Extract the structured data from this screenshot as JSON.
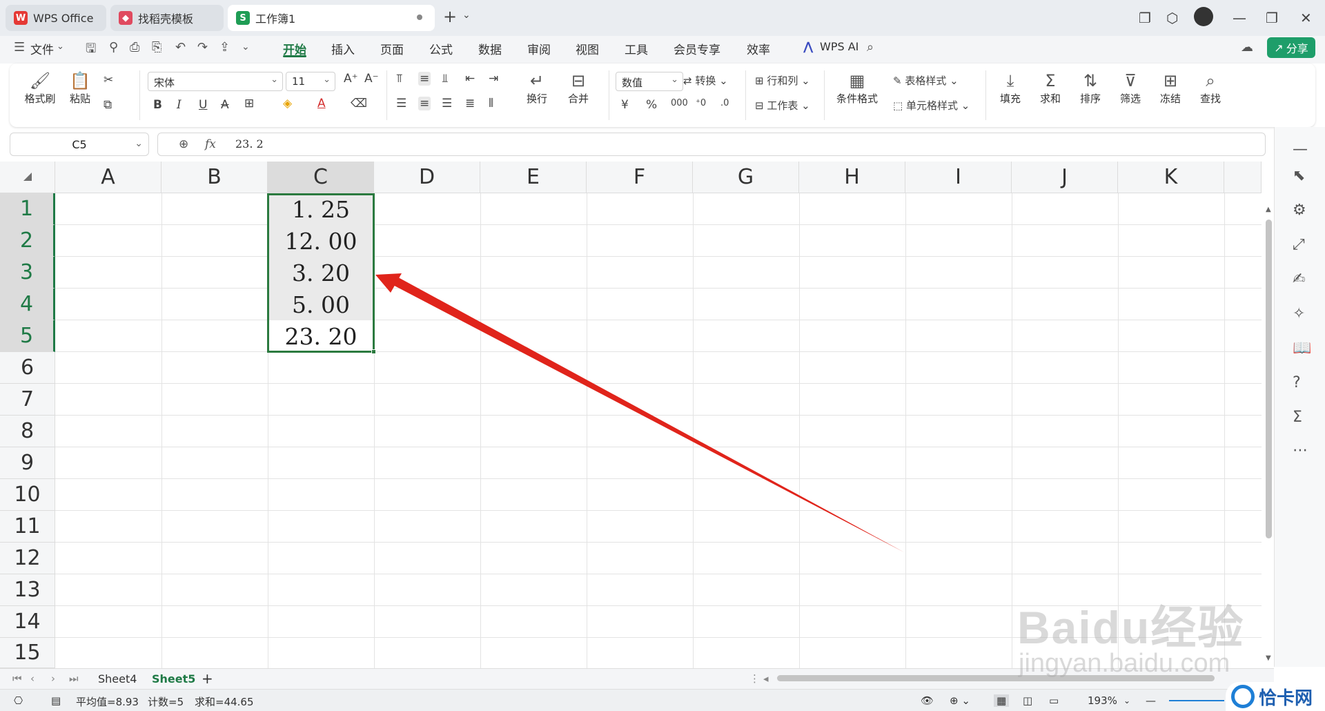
{
  "titlebar": {
    "tabs": [
      {
        "label": "WPS Office"
      },
      {
        "label": "找稻壳模板"
      },
      {
        "label": "工作簿1"
      }
    ]
  },
  "menu": {
    "file": "文件",
    "tabs": [
      "开始",
      "插入",
      "页面",
      "公式",
      "数据",
      "审阅",
      "视图",
      "工具",
      "会员专享",
      "效率"
    ],
    "ai": "WPS AI",
    "share": "分享"
  },
  "ribbon": {
    "format_painter": "格式刷",
    "paste": "粘贴",
    "font_name": "宋体",
    "font_size": "11",
    "wrap": "换行",
    "merge": "合并",
    "number_format": "数值",
    "convert": "转换",
    "row_col": "行和列",
    "worksheet": "工作表",
    "table_style": "表格样式",
    "cond_format": "条件格式",
    "cell_style": "单元格样式",
    "fill": "填充",
    "sum": "求和",
    "sort": "排序",
    "filter": "筛选",
    "freeze": "冻结",
    "find": "查找"
  },
  "formula_bar": {
    "cell_ref": "C5",
    "fx": "fx",
    "value": "23. 2"
  },
  "grid": {
    "columns": [
      "A",
      "B",
      "C",
      "D",
      "E",
      "F",
      "G",
      "H",
      "I",
      "J",
      "K"
    ],
    "rows": [
      "1",
      "2",
      "3",
      "4",
      "5",
      "6",
      "7",
      "8",
      "9",
      "10",
      "11",
      "12",
      "13",
      "14",
      "15"
    ],
    "c_values": [
      "1. 25",
      "12. 00",
      "3. 20",
      "5. 00",
      "23. 20"
    ]
  },
  "sheets": {
    "tabs": [
      "Sheet4",
      "Sheet5"
    ],
    "active": "Sheet5"
  },
  "status": {
    "average": "平均值=8.93",
    "count": "计数=5",
    "sum": "求和=44.65",
    "zoom": "193%"
  },
  "watermark": {
    "brand": "Baidu经验",
    "url": "jingyan.baidu.com",
    "badge": "恰卡网"
  },
  "colors": {
    "accent": "#1f7a46",
    "arrow": "#e0241b",
    "share_button": "#1e9e6a"
  }
}
